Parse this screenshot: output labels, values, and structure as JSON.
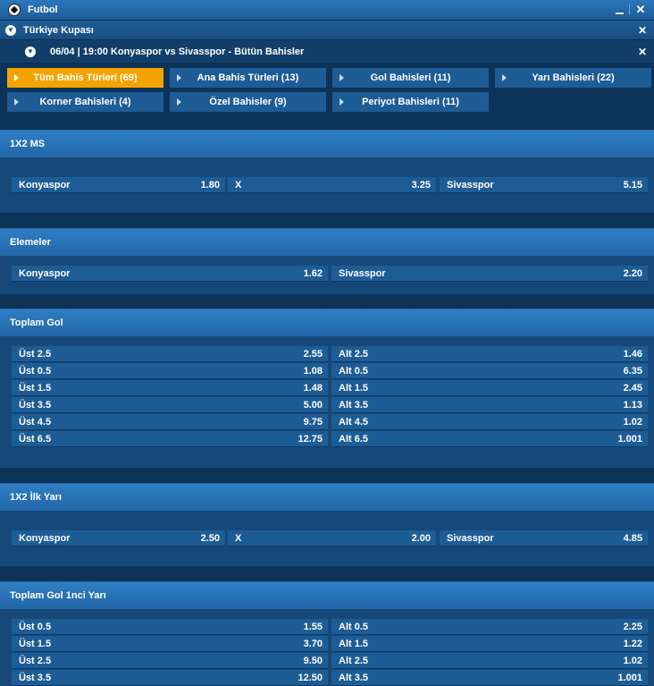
{
  "header": {
    "title": "Futbol"
  },
  "league": {
    "name": "Türkiye Kupası"
  },
  "match": {
    "title": "06/04 | 19:00 Konyaspor vs Sivasspor - Bütün Bahisler"
  },
  "tabs": [
    {
      "label": "Tüm Bahis Türleri (69)",
      "active": true
    },
    {
      "label": "Ana Bahis Türleri (13)"
    },
    {
      "label": "Gol Bahisleri (11)"
    },
    {
      "label": "Yarı Bahisleri (22)"
    },
    {
      "label": "Korner Bahisleri (4)"
    },
    {
      "label": "Özel Bahisler (9)"
    },
    {
      "label": "Periyot Bahisleri (11)"
    }
  ],
  "markets": {
    "ms1x2": {
      "title": "1X2 MS",
      "cells": [
        {
          "label": "Konyaspor",
          "odd": "1.80"
        },
        {
          "label": "X",
          "odd": "3.25"
        },
        {
          "label": "Sivasspor",
          "odd": "5.15"
        }
      ]
    },
    "elemeler": {
      "title": "Elemeler",
      "cells": [
        {
          "label": "Konyaspor",
          "odd": "1.62"
        },
        {
          "label": "Sivasspor",
          "odd": "2.20"
        }
      ]
    },
    "toplam_gol": {
      "title": "Toplam Gol",
      "rows": [
        {
          "over": "Üst 2.5",
          "over_odd": "2.55",
          "under": "Alt 2.5",
          "under_odd": "1.46"
        },
        {
          "over": "Üst 0.5",
          "over_odd": "1.08",
          "under": "Alt 0.5",
          "under_odd": "6.35"
        },
        {
          "over": "Üst 1.5",
          "over_odd": "1.48",
          "under": "Alt 1.5",
          "under_odd": "2.45"
        },
        {
          "over": "Üst 3.5",
          "over_odd": "5.00",
          "under": "Alt 3.5",
          "under_odd": "1.13"
        },
        {
          "over": "Üst 4.5",
          "over_odd": "9.75",
          "under": "Alt 4.5",
          "under_odd": "1.02"
        },
        {
          "over": "Üst 6.5",
          "over_odd": "12.75",
          "under": "Alt 6.5",
          "under_odd": "1.001"
        }
      ]
    },
    "ilk_yari": {
      "title": "1X2 İlk Yarı",
      "cells": [
        {
          "label": "Konyaspor",
          "odd": "2.50"
        },
        {
          "label": "X",
          "odd": "2.00"
        },
        {
          "label": "Sivasspor",
          "odd": "4.85"
        }
      ]
    },
    "toplam_gol_1y": {
      "title": "Toplam Gol 1nci Yarı",
      "rows": [
        {
          "over": "Üst 0.5",
          "over_odd": "1.55",
          "under": "Alt 0.5",
          "under_odd": "2.25"
        },
        {
          "over": "Üst 1.5",
          "over_odd": "3.70",
          "under": "Alt 1.5",
          "under_odd": "1.22"
        },
        {
          "over": "Üst 2.5",
          "over_odd": "9.50",
          "under": "Alt 2.5",
          "under_odd": "1.02"
        },
        {
          "over": "Üst 3.5",
          "over_odd": "12.50",
          "under": "Alt 3.5",
          "under_odd": "1.001"
        }
      ]
    }
  }
}
